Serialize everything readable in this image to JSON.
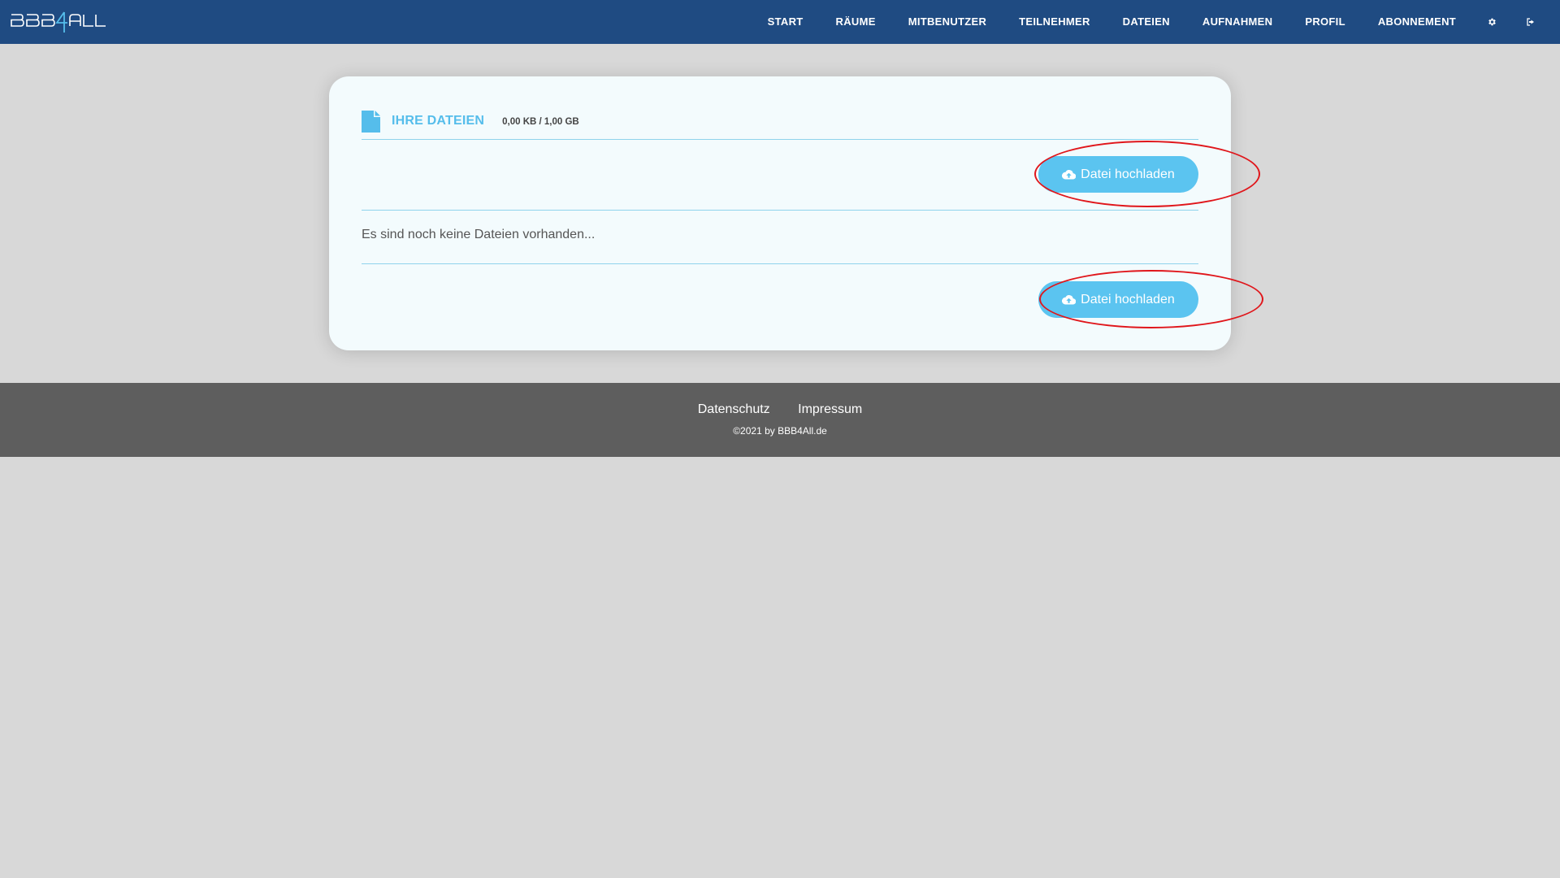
{
  "brand": {
    "logo_text": "BBB4ALL"
  },
  "nav": {
    "items": [
      {
        "label": "START"
      },
      {
        "label": "RÄUME"
      },
      {
        "label": "MITBENUTZER"
      },
      {
        "label": "TEILNEHMER"
      },
      {
        "label": "DATEIEN"
      },
      {
        "label": "AUFNAHMEN"
      },
      {
        "label": "PROFIL"
      },
      {
        "label": "ABONNEMENT"
      }
    ],
    "icons": [
      "gear-icon",
      "logout-icon"
    ]
  },
  "files_card": {
    "icon": "file-icon",
    "title": "IHRE DATEIEN",
    "storage_usage": "0,00 KB / 1,00 GB",
    "upload_button_label": "Datei hochladen",
    "upload_icon": "cloud-upload-icon",
    "empty_message": "Es sind noch keine Dateien vorhanden..."
  },
  "footer": {
    "links": [
      {
        "label": "Datenschutz"
      },
      {
        "label": "Impressum"
      }
    ],
    "copyright": "©2021 by BBB4All.de"
  },
  "colors": {
    "navbar": "#1f4b82",
    "accent": "#55bdeb",
    "button": "#5bc4f0",
    "card_background": "#f3fbfd",
    "page_background": "#d8d8d8",
    "footer": "#5e5e5e",
    "annotation": "#e0161b"
  }
}
